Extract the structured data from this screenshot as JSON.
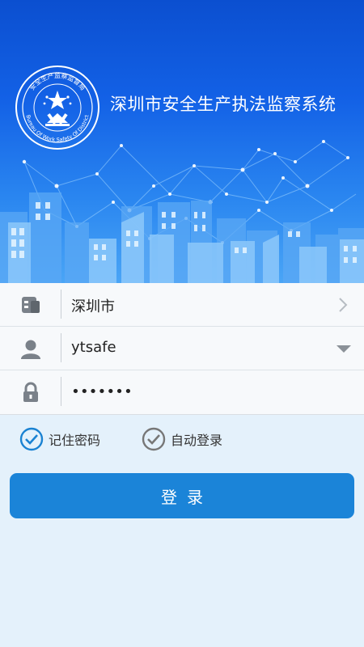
{
  "header": {
    "app_title": "深圳市安全生产执法监察系统",
    "emblem_top_text": "安全生产监察监督局",
    "emblem_bottom_text": "Bureau Of Work Safety Of District"
  },
  "form": {
    "city": {
      "value": "深圳市",
      "icon": "building-icon",
      "trailing_icon": "chevron-right-icon"
    },
    "username": {
      "value": "ytsafe",
      "icon": "user-icon",
      "trailing_icon": "dropdown-arrow-icon"
    },
    "password": {
      "value": "•••••••",
      "icon": "lock-icon"
    }
  },
  "options": {
    "remember_password": {
      "label": "记住密码",
      "checked": true
    },
    "auto_login": {
      "label": "自动登录",
      "checked": true
    }
  },
  "actions": {
    "login_label": "登录"
  },
  "colors": {
    "primary": "#1b84d8",
    "check_active": "#1a82d2",
    "check_gray": "#777777",
    "hero_top": "#0b4fd0",
    "page_bg": "#e4f1fb"
  }
}
